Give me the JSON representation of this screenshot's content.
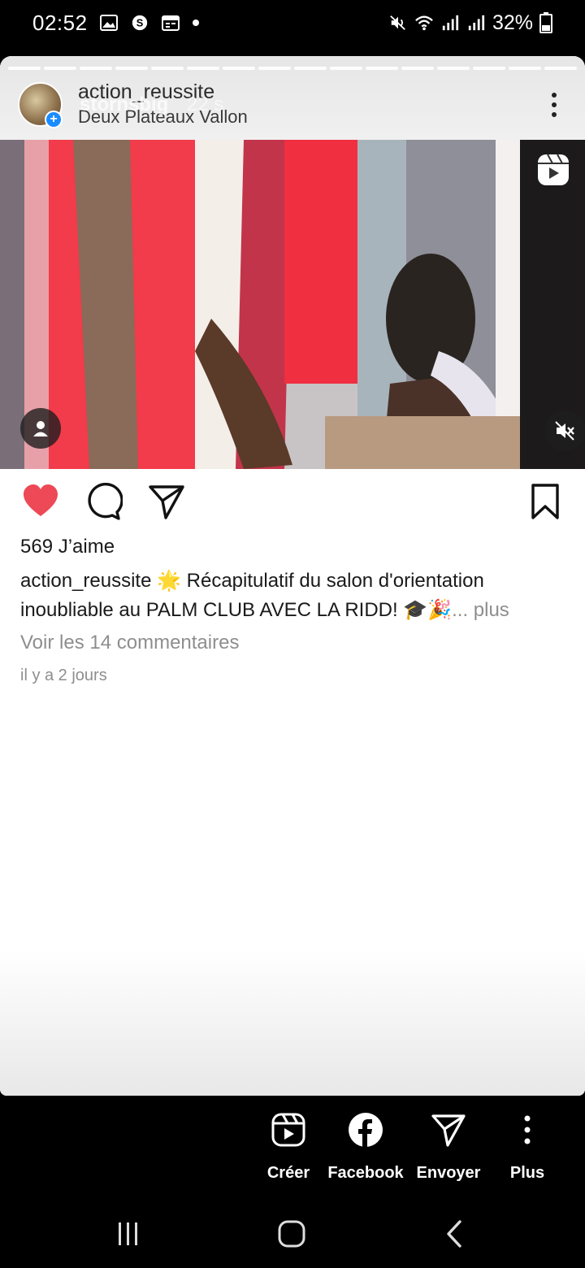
{
  "status_bar": {
    "time": "02:52",
    "battery": "32%"
  },
  "story": {
    "username": "action_reussite",
    "location": "Deux Plateaux Vallon",
    "overlay_username": "stornsbig",
    "overlay_time": "22 s"
  },
  "post": {
    "likes": "569 J’aime",
    "caption_user": "action_reussite",
    "caption_text": " 🌟 Récapitulatif du salon d'orientation inoubliable au PALM CLUB AVEC LA RIDD! 🎓🎉",
    "caption_more": "... plus",
    "comments_link": "Voir les 14 commentaires",
    "time_ago": "il y a 2 jours",
    "liked": true
  },
  "share_bar": {
    "create_label": "Créer",
    "facebook_label": "Facebook",
    "send_label": "Envoyer",
    "more_label": "Plus"
  },
  "colors": {
    "like_red": "#ed4956",
    "facebook_white": "#ffffff",
    "background": "#000000"
  }
}
